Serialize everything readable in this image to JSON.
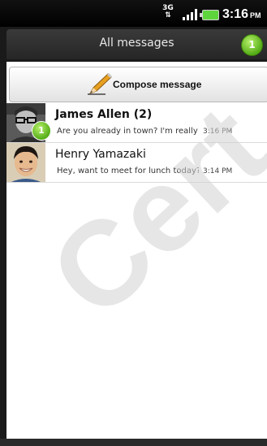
{
  "status_bar": {
    "network": "3G",
    "time": "3:16",
    "ampm": "PM"
  },
  "header": {
    "title": "All messages",
    "unread_count": "1"
  },
  "compose": {
    "label": "Compose message",
    "icon": "pencil-icon"
  },
  "threads": [
    {
      "name": "James Allen (2)",
      "preview": "Are you already in town? I'm really lo",
      "time": "3:16 PM",
      "unread_badge": "1",
      "unread": true
    },
    {
      "name": "Henry Yamazaki",
      "preview": "Hey, want to meet for lunch today?",
      "time": "3:14 PM",
      "unread": false
    }
  ],
  "watermark": "Cert"
}
